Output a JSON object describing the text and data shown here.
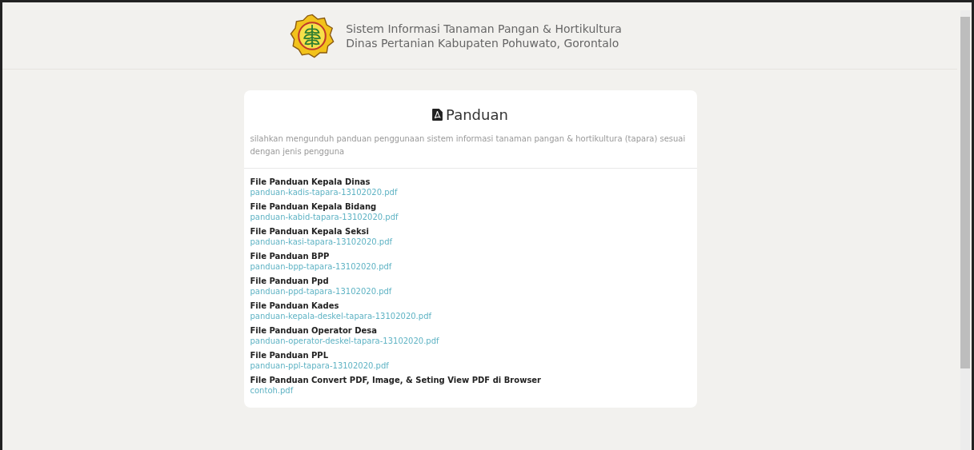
{
  "header": {
    "title": "Sistem Informasi Tanaman Pangan & Hortikultura",
    "subtitle": "Dinas Pertanian Kabupaten Pohuwato, Gorontalo"
  },
  "card": {
    "title": "Panduan",
    "description": "silahkan mengunduh panduan penggunaan sistem informasi tanaman pangan & hortikultura (tapara) sesuai dengan jenis pengguna",
    "files": [
      {
        "label": "File Panduan Kepala Dinas",
        "link": "panduan-kadis-tapara-13102020.pdf"
      },
      {
        "label": "File Panduan Kepala Bidang",
        "link": "panduan-kabid-tapara-13102020.pdf"
      },
      {
        "label": "File Panduan Kepala Seksi",
        "link": "panduan-kasi-tapara-13102020.pdf"
      },
      {
        "label": "File Panduan BPP",
        "link": "panduan-bpp-tapara-13102020.pdf"
      },
      {
        "label": "File Panduan Ppd",
        "link": "panduan-ppd-tapara-13102020.pdf"
      },
      {
        "label": "File Panduan Kades",
        "link": "panduan-kepala-deskel-tapara-13102020.pdf"
      },
      {
        "label": "File Panduan Operator Desa",
        "link": "panduan-operator-deskel-tapara-13102020.pdf"
      },
      {
        "label": "File Panduan PPL",
        "link": "panduan-ppl-tapara-13102020.pdf"
      },
      {
        "label": "File Panduan Convert PDF, Image, & Seting View PDF di Browser",
        "link": "contoh.pdf"
      }
    ]
  }
}
